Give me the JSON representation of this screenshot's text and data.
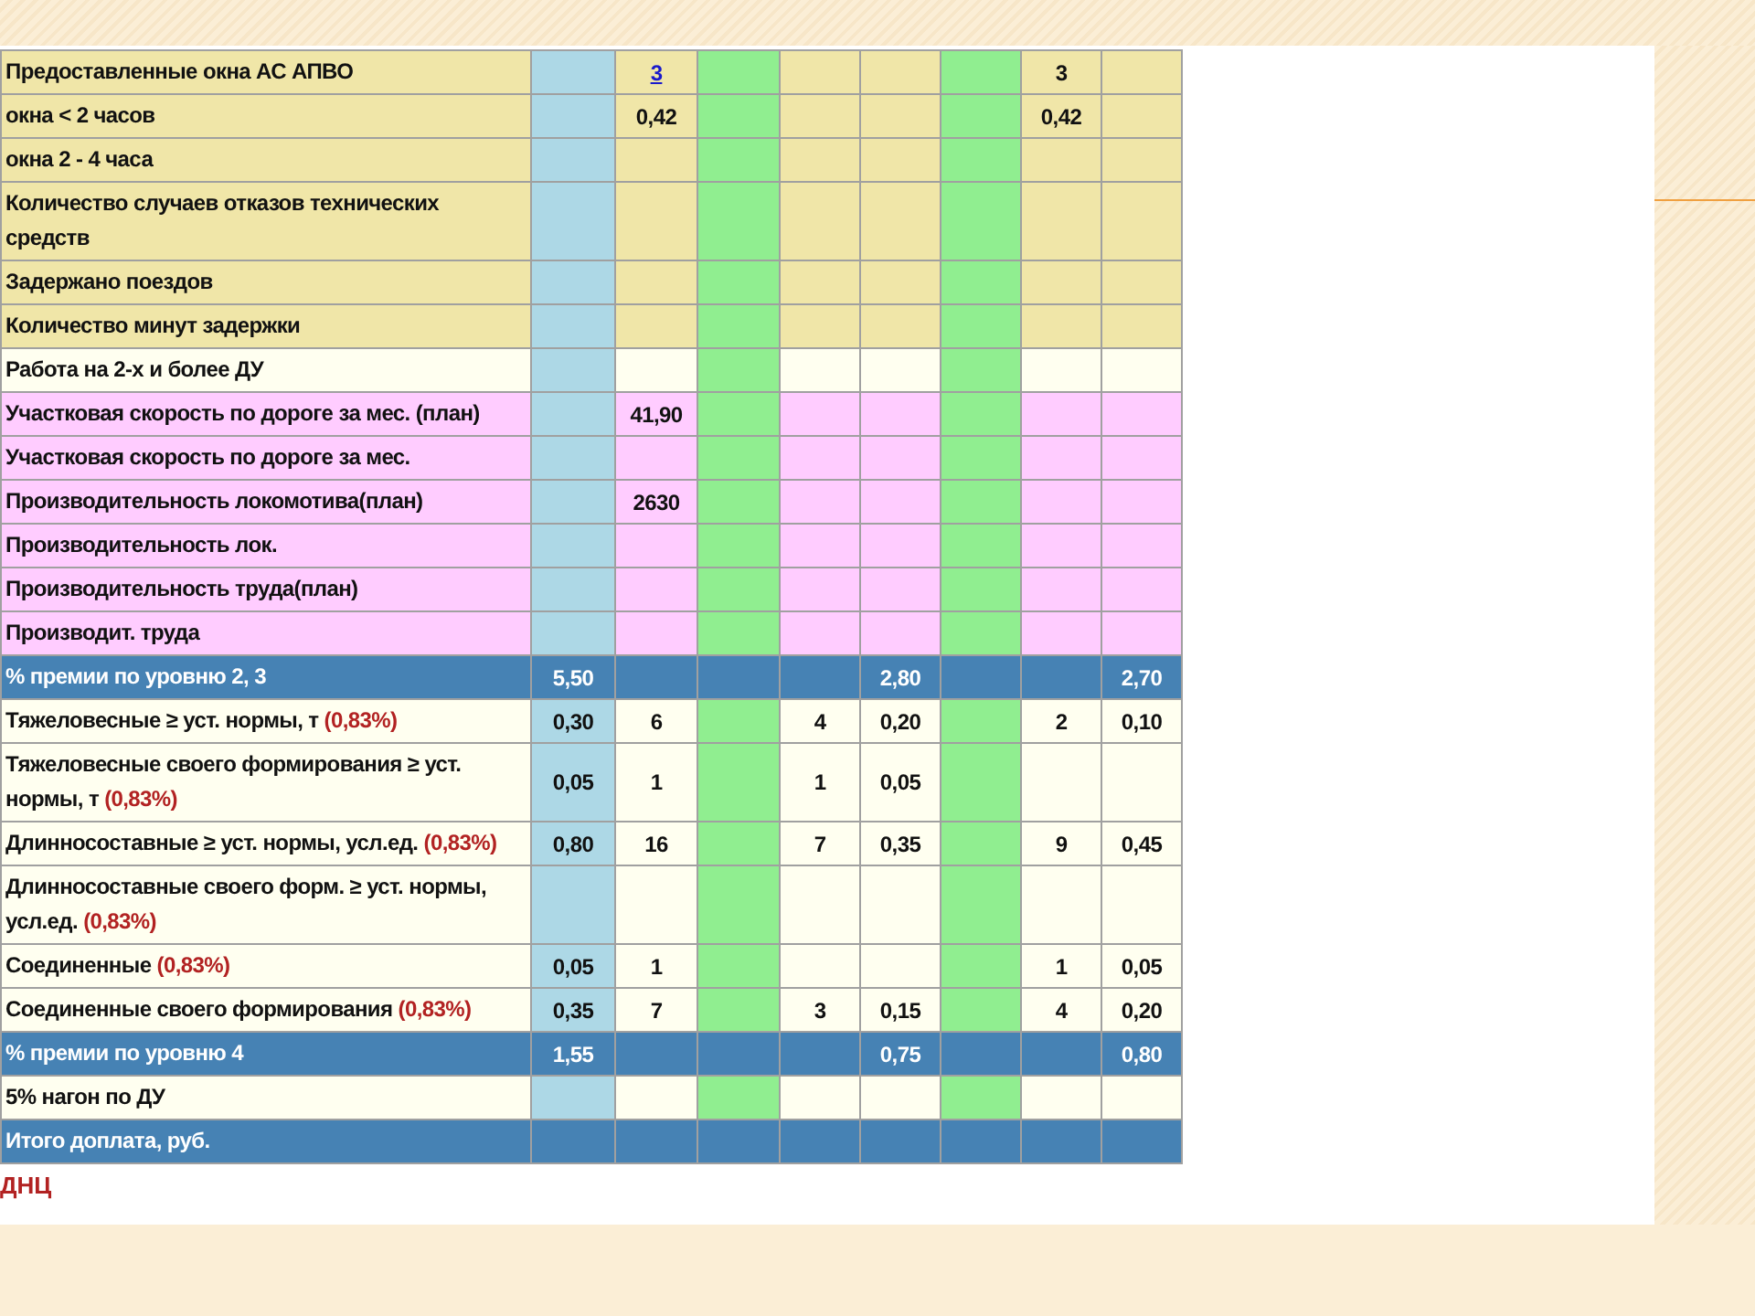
{
  "table": {
    "rows": [
      {
        "kind": "section",
        "label": "Предоставленные окна АС АПВО",
        "cells": [
          "",
          {
            "text": "3",
            "link": true
          },
          "",
          "",
          "",
          "",
          "3",
          ""
        ]
      },
      {
        "kind": "section",
        "label": "окна < 2 часов",
        "cells": [
          "",
          "0,42",
          "",
          "",
          "",
          "",
          "0,42",
          ""
        ]
      },
      {
        "kind": "section",
        "label": "окна 2 - 4 часа",
        "cells": [
          "",
          "",
          "",
          "",
          "",
          "",
          "",
          ""
        ]
      },
      {
        "kind": "section",
        "label": "Количество случаев отказов технических средств",
        "cells": [
          "",
          "",
          "",
          "",
          "",
          "",
          "",
          ""
        ]
      },
      {
        "kind": "section",
        "label": "Задержано поездов",
        "cells": [
          "",
          "",
          "",
          "",
          "",
          "",
          "",
          ""
        ]
      },
      {
        "kind": "section",
        "label": "Количество минут задержки",
        "cells": [
          "",
          "",
          "",
          "",
          "",
          "",
          "",
          ""
        ]
      },
      {
        "kind": "plain",
        "label": "Работа на 2-х и более ДУ",
        "cells": [
          "",
          "",
          "",
          "",
          "",
          "",
          "",
          ""
        ]
      },
      {
        "kind": "pink",
        "label": "Участковая скорость по дороге за мес. (план)",
        "cells": [
          "",
          "41,90",
          "",
          "",
          "",
          "",
          "",
          ""
        ]
      },
      {
        "kind": "pink",
        "label": "Участковая скорость по дороге за мес.",
        "cells": [
          "",
          "",
          "",
          "",
          "",
          "",
          "",
          ""
        ]
      },
      {
        "kind": "pink",
        "label": "Производительность локомотива(план)",
        "cells": [
          "",
          "2630",
          "",
          "",
          "",
          "",
          "",
          ""
        ]
      },
      {
        "kind": "pink",
        "label": "Производительность лок.",
        "cells": [
          "",
          "",
          "",
          "",
          "",
          "",
          "",
          ""
        ]
      },
      {
        "kind": "pink",
        "label": "Производительность труда(план)",
        "cells": [
          "",
          "",
          "",
          "",
          "",
          "",
          "",
          ""
        ]
      },
      {
        "kind": "pink",
        "label": "Производит. труда",
        "cells": [
          "",
          "",
          "",
          "",
          "",
          "",
          "",
          ""
        ]
      },
      {
        "kind": "total",
        "label": "% премии по уровню 2, 3",
        "cells": [
          "5,50",
          "",
          "",
          "",
          "2,80",
          "",
          "",
          "2,70"
        ]
      },
      {
        "kind": "plain",
        "label": "Тяжеловесные ≥ уст. нормы, т",
        "note": "(0,83%)",
        "cells": [
          "0,30",
          "6",
          "",
          "4",
          "0,20",
          "",
          "2",
          "0,10"
        ]
      },
      {
        "kind": "plain",
        "label": "Тяжеловесные своего формирования ≥ уст. нормы, т",
        "note": "(0,83%)",
        "cells": [
          "0,05",
          "1",
          "",
          "1",
          "0,05",
          "",
          "",
          ""
        ]
      },
      {
        "kind": "plain",
        "label": "Длинносоставные ≥ уст. нормы, усл.ед.",
        "note": "(0,83%)",
        "cells": [
          "0,80",
          "16",
          "",
          "7",
          "0,35",
          "",
          "9",
          "0,45"
        ]
      },
      {
        "kind": "plain",
        "label": "Длинносоставные своего форм. ≥ уст. нормы, усл.ед.",
        "note": "(0,83%)",
        "cells": [
          "",
          "",
          "",
          "",
          "",
          "",
          "",
          ""
        ]
      },
      {
        "kind": "plain",
        "label": "Соединенные",
        "note": "(0,83%)",
        "cells": [
          "0,05",
          "1",
          "",
          "",
          "",
          "",
          "1",
          "0,05"
        ]
      },
      {
        "kind": "plain",
        "label": "Соединенные своего формирования",
        "note": "(0,83%)",
        "cells": [
          "0,35",
          "7",
          "",
          "3",
          "0,15",
          "",
          "4",
          "0,20"
        ]
      },
      {
        "kind": "total",
        "label": "% премии по уровню 4",
        "cells": [
          "1,55",
          "",
          "",
          "",
          "0,75",
          "",
          "",
          "0,80"
        ]
      },
      {
        "kind": "plain",
        "label": "5% нагон по ДУ",
        "cells": [
          "",
          "",
          "",
          "",
          "",
          "",
          "",
          ""
        ]
      },
      {
        "kind": "total",
        "label": "Итого доплата, руб.",
        "cells": [
          "",
          "",
          "",
          "",
          "",
          "",
          "",
          ""
        ]
      }
    ]
  },
  "footer": "ДНЦ"
}
